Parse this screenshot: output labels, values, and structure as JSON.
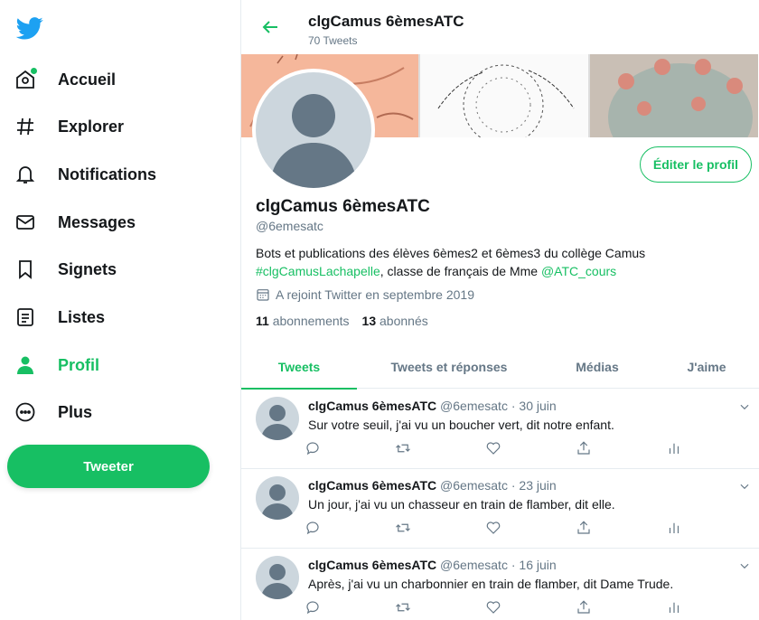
{
  "sidebar": {
    "logo_icon": "twitter-bird-icon",
    "items": [
      {
        "label": "Accueil",
        "icon": "home-icon"
      },
      {
        "label": "Explorer",
        "icon": "hashtag-icon"
      },
      {
        "label": "Notifications",
        "icon": "bell-icon"
      },
      {
        "label": "Messages",
        "icon": "envelope-icon"
      },
      {
        "label": "Signets",
        "icon": "bookmark-icon"
      },
      {
        "label": "Listes",
        "icon": "list-icon"
      },
      {
        "label": "Profil",
        "icon": "person-icon",
        "active": true
      },
      {
        "label": "Plus",
        "icon": "more-circle-icon"
      }
    ],
    "tweet_button": "Tweeter"
  },
  "header": {
    "title": "clgCamus 6èmesATC",
    "subtitle": "70 Tweets"
  },
  "profile": {
    "name": "clgCamus 6èmesATC",
    "handle": "@6emesatc",
    "bio_line1": "Bots et publications des élèves 6èmes2 et 6èmes3 du collège Camus",
    "bio_hashtag": "#clgCamusLachapelle",
    "bio_middle": ", classe de français de Mme ",
    "bio_mention": "@ATC_cours",
    "joined": "A rejoint Twitter en septembre 2019",
    "following_count": "11",
    "following_label": "abonnements",
    "followers_count": "13",
    "followers_label": "abonnés",
    "edit_button": "Éditer le profil"
  },
  "tabs": [
    "Tweets",
    "Tweets et réponses",
    "Médias",
    "J'aime"
  ],
  "tweets": [
    {
      "name": "clgCamus 6èmesATC",
      "handle": "@6emesatc",
      "date": "30 juin",
      "text": "Sur votre seuil, j'ai vu un boucher vert, dit notre enfant."
    },
    {
      "name": "clgCamus 6èmesATC",
      "handle": "@6emesatc",
      "date": "23 juin",
      "text": "Un jour, j'ai vu un chasseur en train de flamber, dit elle."
    },
    {
      "name": "clgCamus 6èmesATC",
      "handle": "@6emesatc",
      "date": "16 juin",
      "text": "Après, j'ai vu un charbonnier en train de flamber, dit Dame Trude."
    }
  ],
  "colors": {
    "accent": "#17bf63",
    "text": "#14171a",
    "muted": "#657786",
    "avatar_bg": "#ccd6dd",
    "logo": "#1da1f2"
  }
}
